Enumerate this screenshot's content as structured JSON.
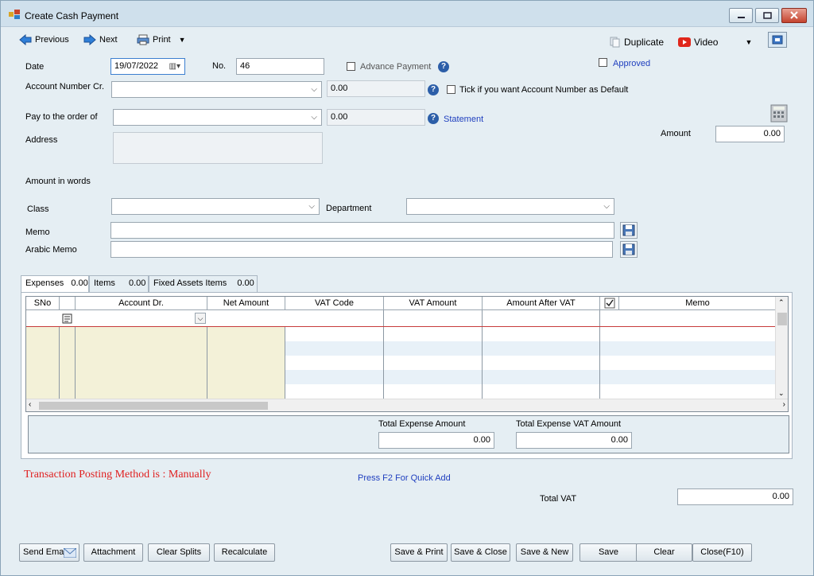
{
  "window": {
    "title": "Create Cash Payment"
  },
  "toolbar": {
    "previous": "Previous",
    "next": "Next",
    "print": "Print",
    "duplicate": "Duplicate",
    "video": "Video"
  },
  "header": {
    "date_label": "Date",
    "date_value": "19/07/2022",
    "no_label": "No.",
    "no_value": "46",
    "advance_payment": "Advance Payment",
    "approved": "Approved",
    "account_cr_label": "Account Number Cr.",
    "account_cr_value": "",
    "account_cr_balance": "0.00",
    "default_tick_label": "Tick if you want Account Number as Default",
    "pay_to_label": "Pay to the order of",
    "pay_to_value": "",
    "pay_to_balance": "0.00",
    "statement": "Statement",
    "address_label": "Address",
    "amount_label": "Amount",
    "amount_value": "0.00",
    "amount_words_label": "Amount in words",
    "class_label": "Class",
    "department_label": "Department",
    "memo_label": "Memo",
    "arabic_memo_label": "Arabic Memo"
  },
  "tabs": [
    {
      "label": "Expenses",
      "count": "0.00"
    },
    {
      "label": "Items",
      "count": "0.00"
    },
    {
      "label": "Fixed Assets Items",
      "count": "0.00"
    }
  ],
  "grid": {
    "columns": [
      "SNo",
      "Account Dr.",
      "Net Amount",
      "VAT Code",
      "VAT Amount",
      "Amount After VAT",
      "Memo"
    ]
  },
  "totals": {
    "total_expense_label": "Total Expense Amount",
    "total_expense_value": "0.00",
    "total_expense_vat_label": "Total Expense VAT Amount",
    "total_expense_vat_value": "0.00"
  },
  "footer": {
    "posting_method": "Transaction Posting Method is : Manually",
    "quick_add_hint": "Press F2 For Quick Add",
    "total_vat_label": "Total VAT",
    "total_vat_value": "0.00"
  },
  "buttons": {
    "send_email": "Send Email",
    "attachment": "Attachment",
    "clear_splits": "Clear Splits",
    "recalculate": "Recalculate",
    "save_print": "Save & Print",
    "save_close": "Save & Close",
    "save_new": "Save & New",
    "save": "Save",
    "clear": "Clear",
    "close": "Close(F10)"
  },
  "colors": {
    "link": "#1f3fbf",
    "posting_red": "#e02020",
    "grid_tan": "#f3f1d8",
    "window_bg": "#e5eef3"
  }
}
